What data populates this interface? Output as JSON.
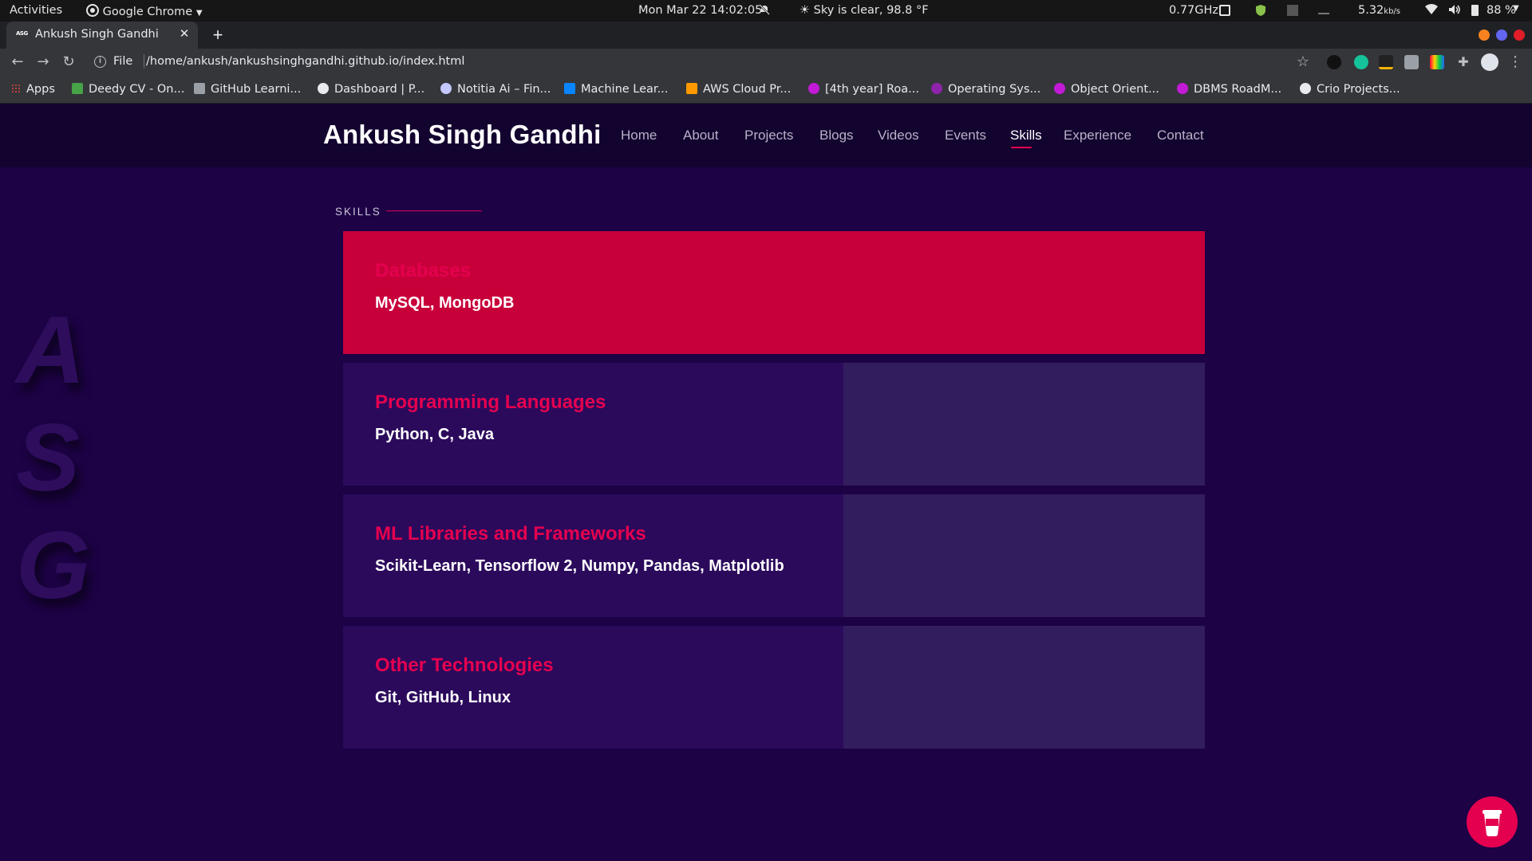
{
  "os_bar": {
    "activities": "Activities",
    "app_name": "Google Chrome",
    "datetime": "Mon Mar 22  14:02:05",
    "weather": "Sky is clear, 98.8 °F",
    "cpu": "0.77GHz",
    "net_speed": "5.32",
    "net_unit": "kb/s",
    "battery": "88 %"
  },
  "browser": {
    "tab_title": "Ankush Singh Gandhi",
    "tab_favicon_text": "ASG",
    "url_scheme": "File",
    "url": "/home/ankush/ankushsinghgandhi.github.io/index.html"
  },
  "bookmarks": [
    {
      "label": "Apps",
      "color": "#4285f4"
    },
    {
      "label": "Deedy CV - On...",
      "color": "#47a248"
    },
    {
      "label": "GitHub Learni...",
      "color": "#9aa0a6"
    },
    {
      "label": "Dashboard | P...",
      "color": "#e8eaed"
    },
    {
      "label": "Notitia Ai – Fin...",
      "color": "#c5c8ff"
    },
    {
      "label": "Machine Lear...",
      "color": "#0a84ff"
    },
    {
      "label": "AWS Cloud Pr...",
      "color": "#ff9900"
    },
    {
      "label": "[4th year] Roa...",
      "color": "#c21ad6"
    },
    {
      "label": "Operating Sys...",
      "color": "#8e24aa"
    },
    {
      "label": "Object Orient...",
      "color": "#c21ad6"
    },
    {
      "label": "DBMS RoadM...",
      "color": "#c21ad6"
    },
    {
      "label": "Crio Projects...",
      "color": "#e8eaed"
    }
  ],
  "site": {
    "brand": "Ankush Singh Gandhi",
    "nav": [
      "Home",
      "About",
      "Projects",
      "Blogs",
      "Videos",
      "Events",
      "Skills",
      "Experience",
      "Contact"
    ],
    "active_nav": "Skills",
    "watermark": [
      "A",
      "S",
      "G"
    ],
    "section_label": "SKILLS",
    "skills": [
      {
        "title": "Databases",
        "items": "MySQL, MongoDB",
        "active": true
      },
      {
        "title": "Programming Languages",
        "items": "Python, C, Java",
        "active": false
      },
      {
        "title": "ML Libraries and Frameworks",
        "items": "Scikit-Learn, Tensorflow 2, Numpy, Pandas, Matplotlib",
        "active": false
      },
      {
        "title": "Other Technologies",
        "items": "Git, GitHub, Linux",
        "active": false
      }
    ],
    "accent_color": "#e5004f",
    "background_color": "#1d0246"
  }
}
